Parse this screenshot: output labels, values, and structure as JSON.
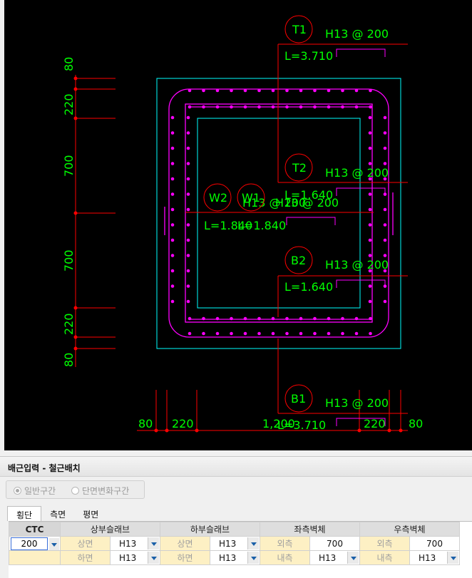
{
  "drawing": {
    "dim_left": [
      "80",
      "220",
      "700",
      "700",
      "220",
      "80"
    ],
    "dim_bottom": [
      "80",
      "220",
      "1,200",
      "220",
      "80"
    ],
    "labels": {
      "T1": {
        "tag": "T1",
        "spec": "H13 @ 200",
        "length": "L=3.710"
      },
      "T2": {
        "tag": "T2",
        "spec": "H13 @ 200",
        "length": "L=1.640"
      },
      "B2": {
        "tag": "B2",
        "spec": "H13 @ 200",
        "length": "L=1.640"
      },
      "B1": {
        "tag": "B1",
        "spec": "H13 @ 200",
        "length": "L=3.710"
      },
      "W2": {
        "tag": "W2",
        "spec": "H13 @ 200",
        "length": "L=1.840"
      },
      "W1": {
        "tag": "W1",
        "spec": "H13 @ 200",
        "length": "L=1.840"
      }
    },
    "colors": {
      "background": "#000000",
      "dim": "#ff0000",
      "text": "#00ff00",
      "rebar": "#ff00ff",
      "outline": "#00ffff"
    }
  },
  "panel": {
    "title": "배근입력 - 철근배치",
    "radio": {
      "general": "일반구간",
      "variable": "단면변화구간"
    },
    "tabs": [
      "횡단",
      "측면",
      "평면"
    ],
    "grid": {
      "ctc_header": "CTC",
      "groups": [
        "상부슬래브",
        "하부슬래브",
        "좌측벽체",
        "우측벽체"
      ],
      "ctc_value": "200",
      "row1": {
        "top_slab_label": "상면",
        "top_slab_val": "H13",
        "bot_slab_label": "상면",
        "bot_slab_val": "H13",
        "left_label": "외측",
        "left_val": "700",
        "right_label": "외측",
        "right_val": "700"
      },
      "row2": {
        "top_slab_label": "하면",
        "top_slab_val": "H13",
        "bot_slab_label": "하면",
        "bot_slab_val": "H13",
        "left_label": "내측",
        "left_val": "H13",
        "right_label": "내측",
        "right_val": "H13"
      }
    }
  }
}
